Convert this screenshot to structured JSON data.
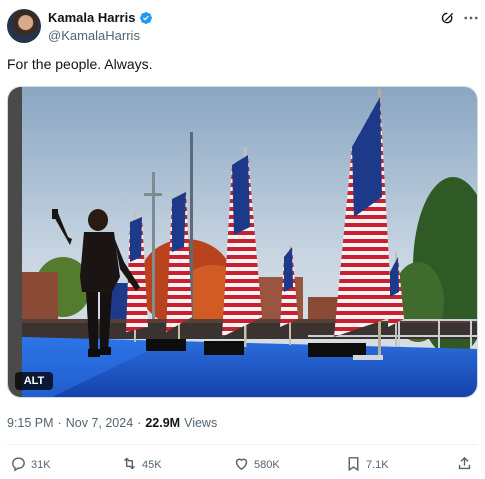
{
  "author": {
    "display_name": "Kamala Harris",
    "handle": "@KamalaHarris",
    "verified_color": "#1d9bf0"
  },
  "header_icons": [
    "grok-icon",
    "more-icon"
  ],
  "tweet": {
    "text": "For the people. Always."
  },
  "media": {
    "alt_label": "ALT"
  },
  "meta": {
    "time": "9:15 PM",
    "separator": "·",
    "date": "Nov 7, 2024",
    "separator2": "·",
    "views_count": "22.9M",
    "views_label": "Views"
  },
  "actions": {
    "replies": "31K",
    "reposts": "45K",
    "likes": "580K",
    "bookmarks": "7.1K"
  },
  "colors": {
    "text": "#0f1419",
    "secondary": "#536471",
    "stage_blue": "#1f63d6"
  }
}
